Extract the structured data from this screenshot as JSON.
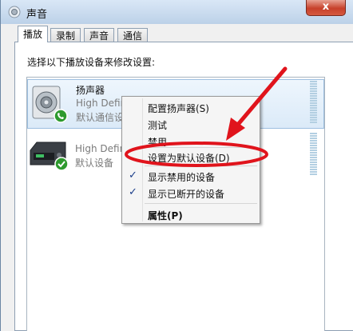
{
  "window": {
    "title": "声音",
    "close_label": "x"
  },
  "tabs": [
    {
      "label": "播放",
      "active": true
    },
    {
      "label": "录制",
      "active": false
    },
    {
      "label": "声音",
      "active": false
    },
    {
      "label": "通信",
      "active": false
    }
  ],
  "instruction": "选择以下播放设备来修改设置:",
  "devices": [
    {
      "name": "扬声器",
      "description": "High Definit",
      "status": "默认通信设备",
      "selected": true,
      "status_icon": "phone-badge-icon"
    },
    {
      "name": "",
      "description": "High Defin",
      "status": "默认设备",
      "selected": false,
      "status_icon": "check-badge-icon"
    }
  ],
  "context_menu": {
    "items": [
      {
        "label": "配置扬声器(S)",
        "checked": false,
        "bold": false
      },
      {
        "label": "测试",
        "checked": false,
        "bold": false
      },
      {
        "label": "禁用",
        "checked": false,
        "bold": false
      },
      {
        "label": "设置为默认设备(D)",
        "checked": false,
        "bold": false,
        "highlighted_annotation": true
      },
      {
        "label": "显示禁用的设备",
        "checked": true,
        "bold": false
      },
      {
        "label": "显示已断开的设备",
        "checked": true,
        "bold": false
      },
      {
        "label": "属性(P)",
        "checked": false,
        "bold": true
      }
    ]
  },
  "colors": {
    "annotation_red": "#e0141c",
    "selection_blue": "#dbeaf8",
    "close_red": "#c7402b"
  }
}
